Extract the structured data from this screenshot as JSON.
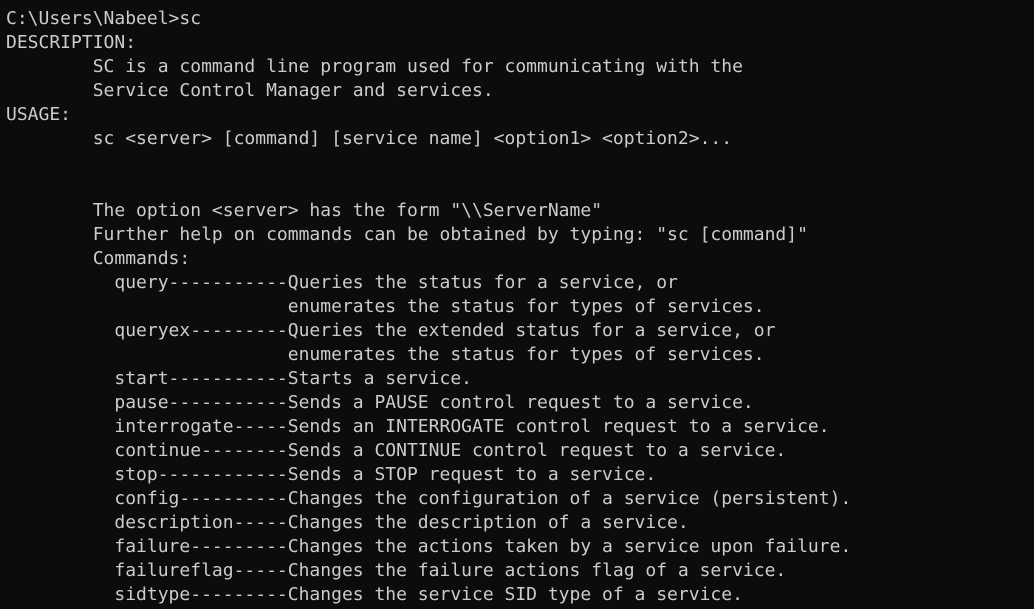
{
  "console": {
    "lines": [
      "C:\\Users\\Nabeel>sc",
      "DESCRIPTION:",
      "        SC is a command line program used for communicating with the",
      "        Service Control Manager and services.",
      "USAGE:",
      "        sc <server> [command] [service name] <option1> <option2>...",
      "",
      "",
      "        The option <server> has the form \"\\\\ServerName\"",
      "        Further help on commands can be obtained by typing: \"sc [command]\"",
      "        Commands:",
      "          query-----------Queries the status for a service, or",
      "                          enumerates the status for types of services.",
      "          queryex---------Queries the extended status for a service, or",
      "                          enumerates the status for types of services.",
      "          start-----------Starts a service.",
      "          pause-----------Sends a PAUSE control request to a service.",
      "          interrogate-----Sends an INTERROGATE control request to a service.",
      "          continue--------Sends a CONTINUE control request to a service.",
      "          stop------------Sends a STOP request to a service.",
      "          config----------Changes the configuration of a service (persistent).",
      "          description-----Changes the description of a service.",
      "          failure---------Changes the actions taken by a service upon failure.",
      "          failureflag-----Changes the failure actions flag of a service.",
      "          sidtype---------Changes the service SID type of a service."
    ]
  }
}
